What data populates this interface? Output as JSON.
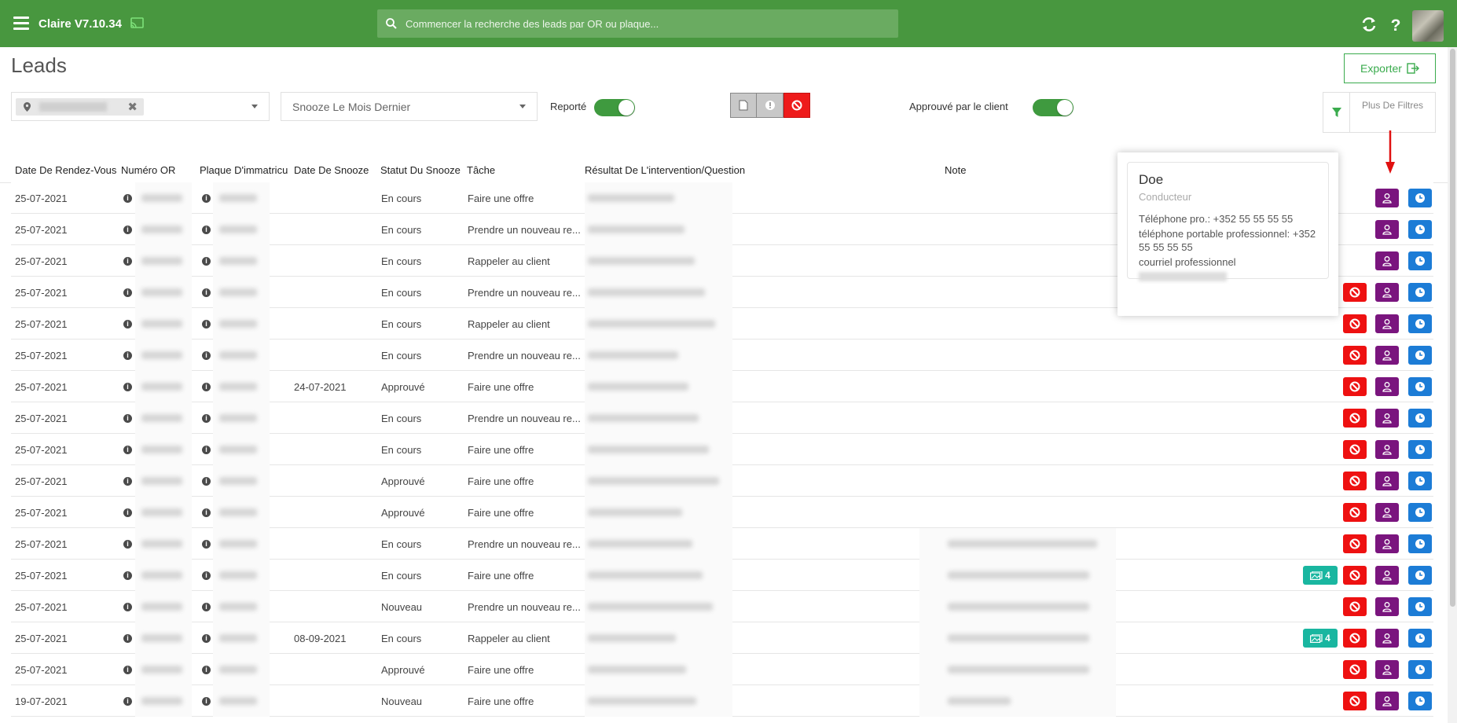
{
  "app": {
    "title": "Claire V7.10.34"
  },
  "search": {
    "placeholder": "Commencer la recherche des leads par OR ou plaque..."
  },
  "page": {
    "title": "Leads",
    "export_label": "Exporter"
  },
  "filters": {
    "snooze_value": "Snooze Le Mois Dernier",
    "reporte_label": "Reporté",
    "reporte_on": true,
    "approuve_label": "Approuvé par le client",
    "approuve_on": true,
    "more_filters_label": "Plus De Filtres"
  },
  "table": {
    "columns": [
      "Date De Rendez-Vous",
      "Numéro OR",
      "Plaque D'immatricu",
      "Date De Snooze",
      "Statut Du Snooze",
      "Tâche",
      "Résultat De L'intervention/Question",
      "Note"
    ],
    "rows": [
      {
        "date": "25-07-2021",
        "snooze_date": "",
        "status": "En cours",
        "task": "Faire une offre",
        "badge": "",
        "has_red": false
      },
      {
        "date": "25-07-2021",
        "snooze_date": "",
        "status": "En cours",
        "task": "Prendre un nouveau re...",
        "badge": "",
        "has_red": false
      },
      {
        "date": "25-07-2021",
        "snooze_date": "",
        "status": "En cours",
        "task": "Rappeler au client",
        "badge": "",
        "has_red": false
      },
      {
        "date": "25-07-2021",
        "snooze_date": "",
        "status": "En cours",
        "task": "Prendre un nouveau re...",
        "badge": "",
        "has_red": true
      },
      {
        "date": "25-07-2021",
        "snooze_date": "",
        "status": "En cours",
        "task": "Rappeler au client",
        "badge": "",
        "has_red": true
      },
      {
        "date": "25-07-2021",
        "snooze_date": "",
        "status": "En cours",
        "task": "Prendre un nouveau re...",
        "badge": "",
        "has_red": true
      },
      {
        "date": "25-07-2021",
        "snooze_date": "24-07-2021",
        "status": "Approuvé",
        "task": "Faire une offre",
        "badge": "",
        "has_red": true
      },
      {
        "date": "25-07-2021",
        "snooze_date": "",
        "status": "En cours",
        "task": "Prendre un nouveau re...",
        "badge": "",
        "has_red": true
      },
      {
        "date": "25-07-2021",
        "snooze_date": "",
        "status": "En cours",
        "task": "Faire une offre",
        "badge": "",
        "has_red": true
      },
      {
        "date": "25-07-2021",
        "snooze_date": "",
        "status": "Approuvé",
        "task": "Faire une offre",
        "badge": "",
        "has_red": true
      },
      {
        "date": "25-07-2021",
        "snooze_date": "",
        "status": "Approuvé",
        "task": "Faire une offre",
        "badge": "",
        "has_red": true
      },
      {
        "date": "25-07-2021",
        "snooze_date": "",
        "status": "En cours",
        "task": "Prendre un nouveau re...",
        "badge": "",
        "has_red": true
      },
      {
        "date": "25-07-2021",
        "snooze_date": "",
        "status": "En cours",
        "task": "Faire une offre",
        "badge": "4",
        "has_red": true
      },
      {
        "date": "25-07-2021",
        "snooze_date": "",
        "status": "Nouveau",
        "task": "Prendre un nouveau re...",
        "badge": "",
        "has_red": true
      },
      {
        "date": "25-07-2021",
        "snooze_date": "08-09-2021",
        "status": "En cours",
        "task": "Rappeler au client",
        "badge": "4",
        "has_red": true
      },
      {
        "date": "25-07-2021",
        "snooze_date": "",
        "status": "Approuvé",
        "task": "Faire une offre",
        "badge": "",
        "has_red": true
      },
      {
        "date": "19-07-2021",
        "snooze_date": "",
        "status": "Nouveau",
        "task": "Faire une offre",
        "badge": "",
        "has_red": true
      }
    ]
  },
  "popover": {
    "name": "Doe",
    "role": "Conducteur",
    "phone_pro": "Téléphone pro.: +352 55 55 55 55",
    "mobile_pro": "téléphone portable professionnel: +352 55 55 55 55",
    "email_label": "courriel professionnel"
  },
  "colors": {
    "topbar": "#48973f",
    "accent_green": "#3aab4d",
    "red": "#ee1111",
    "purple": "#7a157e",
    "blue": "#1c7cd6",
    "teal": "#19b6a0"
  }
}
